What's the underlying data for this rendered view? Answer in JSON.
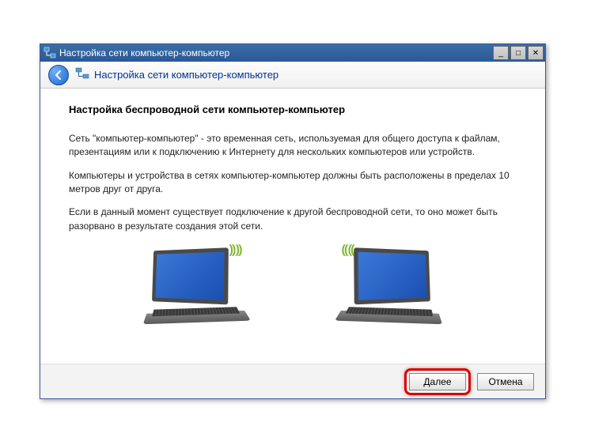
{
  "window": {
    "title": "Настройка сети компьютер-компьютер"
  },
  "header": {
    "title": "Настройка сети компьютер-компьютер"
  },
  "content": {
    "heading": "Настройка беспроводной сети компьютер-компьютер",
    "p1": "Сеть \"компьютер-компьютер\" - это временная сеть, используемая для общего доступа к файлам, презентациям или к подключению к Интернету для нескольких компьютеров или устройств.",
    "p2": "Компьютеры и устройства в сетях компьютер-компьютер должны быть расположены в пределах 10 метров друг от друга.",
    "p3": "Если в данный момент существует подключение к другой беспроводной сети, то оно может быть разорвано в результате создания этой сети."
  },
  "footer": {
    "next": "Далее",
    "cancel": "Отмена"
  },
  "winControls": {
    "minimize": "_",
    "maximize": "□",
    "close": "✕"
  }
}
